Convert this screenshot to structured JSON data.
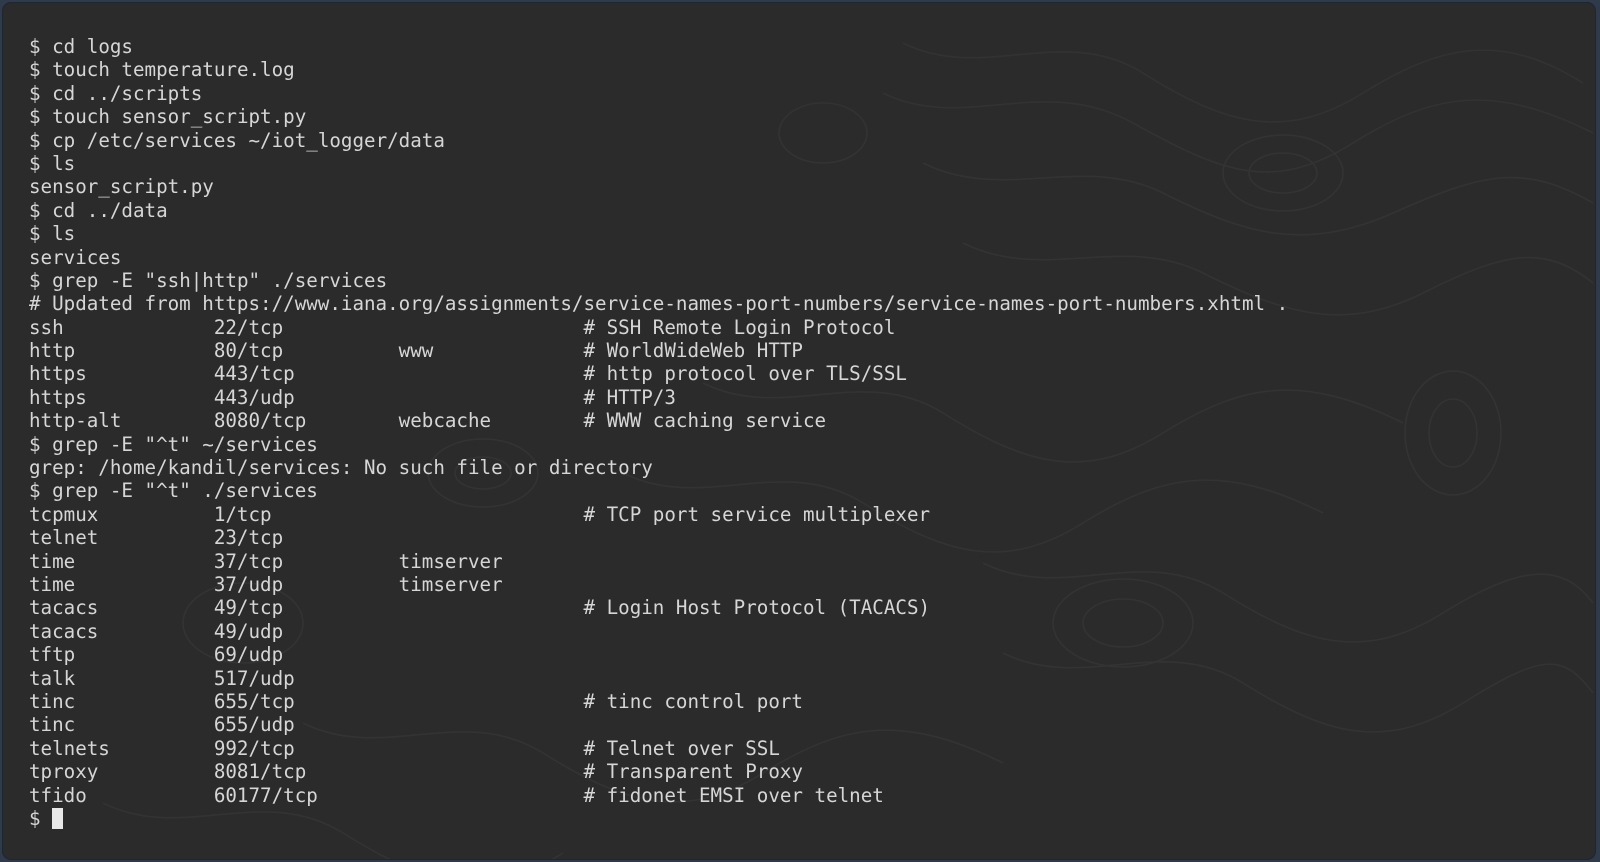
{
  "terminal": {
    "prompt": "$",
    "lines": [
      {
        "kind": "cmd",
        "text": "cd logs"
      },
      {
        "kind": "cmd",
        "text": "touch temperature.log"
      },
      {
        "kind": "cmd",
        "text": "cd ../scripts"
      },
      {
        "kind": "cmd",
        "text": "touch sensor_script.py"
      },
      {
        "kind": "cmd",
        "text": "cp /etc/services ~/iot_logger/data"
      },
      {
        "kind": "cmd",
        "text": "ls"
      },
      {
        "kind": "out",
        "text": "sensor_script.py"
      },
      {
        "kind": "cmd",
        "text": "cd ../data"
      },
      {
        "kind": "cmd",
        "text": "ls"
      },
      {
        "kind": "out",
        "text": "services"
      },
      {
        "kind": "cmd",
        "text": "grep -E \"ssh|http\" ./services"
      },
      {
        "kind": "out",
        "text": "# Updated from https://www.iana.org/assignments/service-names-port-numbers/service-names-port-numbers.xhtml ."
      },
      {
        "kind": "out",
        "text": "ssh             22/tcp                          # SSH Remote Login Protocol"
      },
      {
        "kind": "out",
        "text": "http            80/tcp          www             # WorldWideWeb HTTP"
      },
      {
        "kind": "out",
        "text": "https           443/tcp                         # http protocol over TLS/SSL"
      },
      {
        "kind": "out",
        "text": "https           443/udp                         # HTTP/3"
      },
      {
        "kind": "out",
        "text": "http-alt        8080/tcp        webcache        # WWW caching service"
      },
      {
        "kind": "cmd",
        "text": "grep -E \"^t\" ~/services"
      },
      {
        "kind": "out",
        "text": "grep: /home/kandil/services: No such file or directory"
      },
      {
        "kind": "cmd",
        "text": "grep -E \"^t\" ./services"
      },
      {
        "kind": "out",
        "text": "tcpmux          1/tcp                           # TCP port service multiplexer"
      },
      {
        "kind": "out",
        "text": "telnet          23/tcp"
      },
      {
        "kind": "out",
        "text": "time            37/tcp          timserver"
      },
      {
        "kind": "out",
        "text": "time            37/udp          timserver"
      },
      {
        "kind": "out",
        "text": "tacacs          49/tcp                          # Login Host Protocol (TACACS)"
      },
      {
        "kind": "out",
        "text": "tacacs          49/udp"
      },
      {
        "kind": "out",
        "text": "tftp            69/udp"
      },
      {
        "kind": "out",
        "text": "talk            517/udp"
      },
      {
        "kind": "out",
        "text": "tinc            655/tcp                         # tinc control port"
      },
      {
        "kind": "out",
        "text": "tinc            655/udp"
      },
      {
        "kind": "out",
        "text": "telnets         992/tcp                         # Telnet over SSL"
      },
      {
        "kind": "out",
        "text": "tproxy          8081/tcp                        # Transparent Proxy"
      },
      {
        "kind": "out",
        "text": "tfido           60177/tcp                       # fidonet EMSI over telnet"
      }
    ],
    "current_input": ""
  },
  "colors": {
    "background": "#2b2b2b",
    "text": "#d6d6d6",
    "cursor": "#e8e8e8",
    "frame": "#2f3a4a"
  }
}
